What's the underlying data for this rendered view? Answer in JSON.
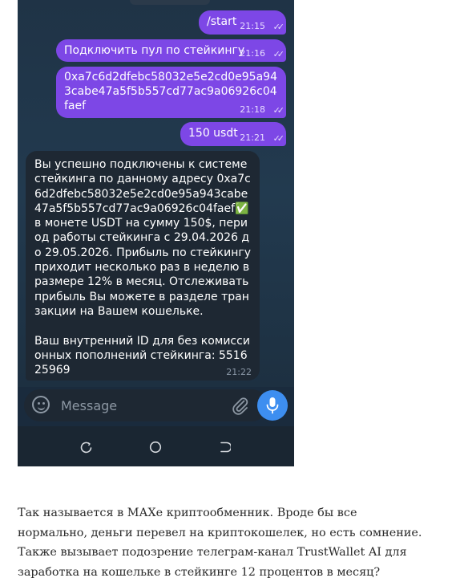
{
  "chat": {
    "messages": [
      {
        "dir": "out",
        "text": "/start",
        "time": "21:15"
      },
      {
        "dir": "out",
        "text": "Подключить пул по стейкингу",
        "time": "21:16"
      },
      {
        "dir": "out",
        "text": "0xa7c6d2dfebc58032e5e2cd0e95a943cabe47a5f5b557cd77ac9a06926c04faef",
        "time": "21:18"
      },
      {
        "dir": "out",
        "text": "150 usdt",
        "time": "21:21"
      },
      {
        "dir": "in",
        "text": "Вы успешно подключены к системе стейкинга по данному адресу 0xa7c6d2dfebc58032e5e2cd0e95a943cabe47a5f5b557cd77ac9a06926c04faef✅ в монете USDT на сумму 150$, период работы стейкинга с 29.04.2026 до 29.05.2026. Прибыль по стейкингу приходит несколько раз в неделю в размере 12% в месяц. Отслеживать прибыль Вы можете в разделе транзакции на Вашем кошельке.\n\nВаш внутренний ID для без комиссионных пополнений стейкинга: 551625969",
        "time": "21:22"
      }
    ]
  },
  "composer": {
    "placeholder": "Message"
  },
  "icons": {
    "emoji": "smiley-face-icon",
    "attach": "paperclip-icon",
    "mic": "microphone-icon",
    "nav_recent": "recent-apps-icon",
    "nav_home": "home-circle-icon",
    "nav_back": "back-icon"
  },
  "colors": {
    "outgoing_bubble": "#7d47e6",
    "incoming_bubble": "#1e2833",
    "mic_button": "#3d8ef0",
    "chat_background": "#1f3346"
  },
  "caption": {
    "text": "Так называется в МАХе криптообменник. Вроде бы все нормально, деньги перевел на криптокошелек, но есть сомнение. Также вызывает подозрение телеграм-канал TrustWallet AI для заработка на кошельке в стейкинге 12 процентов в месяц?"
  }
}
